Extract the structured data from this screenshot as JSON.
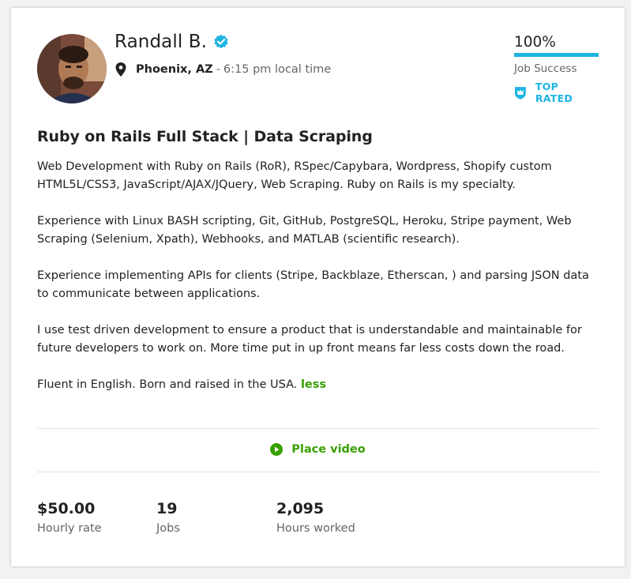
{
  "profile": {
    "name": "Randall B.",
    "verified_icon": "verified-check-icon",
    "city": "Phoenix, AZ",
    "separator": "-",
    "local_time": "6:15 pm local time",
    "avatar_icon": "profile-photo"
  },
  "job_success": {
    "percent_text": "100%",
    "percent_value": 100,
    "label": "Job Success",
    "badge_label": "TOP RATED",
    "badge_icon": "top-rated-crown-icon"
  },
  "overview": {
    "title": "Ruby on Rails Full Stack | Data Scraping",
    "paragraphs": [
      "Web Development with Ruby on Rails (RoR), RSpec/Capybara, Wordpress, Shopify custom HTML5L/CSS3, JavaScript/AJAX/JQuery, Web Scraping. Ruby on Rails is my specialty.",
      "Experience with Linux BASH scripting, Git, GitHub, PostgreSQL, Heroku, Stripe payment, Web Scraping (Selenium, Xpath), Webhooks, and MATLAB (scientific research).",
      "Experience implementing APIs for clients (Stripe, Backblaze, Etherscan, ) and parsing JSON data to communicate between applications.",
      "I use test driven development to ensure a product that is understandable and maintainable for future developers to work on. More time put in up front means far less costs down the road.",
      "Fluent in English. Born and raised in the USA."
    ],
    "less_link": "less"
  },
  "video": {
    "label": "Place video",
    "icon": "play-circle-icon"
  },
  "stats": [
    {
      "value": "$50.00",
      "label": "Hourly rate"
    },
    {
      "value": "19",
      "label": "Jobs"
    },
    {
      "value": "2,095",
      "label": "Hours worked"
    }
  ],
  "colors": {
    "accent_green": "#37a000",
    "accent_blue": "#1eb4e4",
    "muted_text": "#656565"
  }
}
